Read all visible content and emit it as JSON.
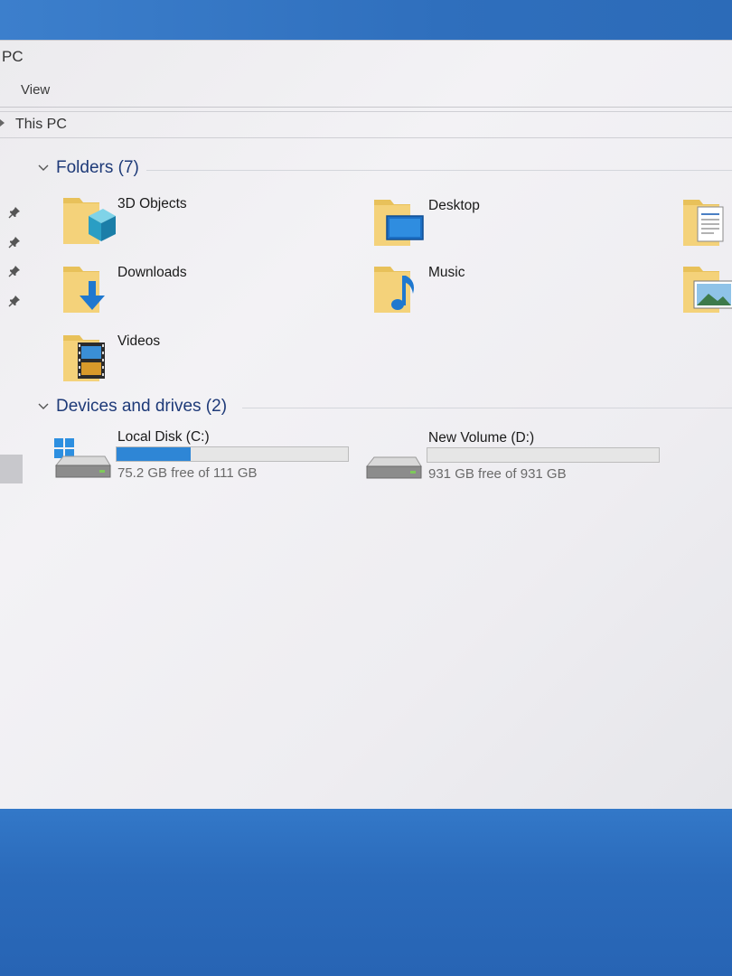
{
  "window": {
    "title": "PC"
  },
  "ribbon": {
    "tabs": [
      {
        "label": "View"
      }
    ]
  },
  "address_bar": {
    "path": "This PC"
  },
  "nav_pane": {
    "pinned_icons": [
      "pin-icon",
      "pin-icon",
      "pin-icon",
      "pin-icon"
    ]
  },
  "folders": {
    "header": "Folders (7)",
    "items": [
      {
        "name": "3D Objects",
        "icon": "3d-objects-folder-icon"
      },
      {
        "name": "Desktop",
        "icon": "desktop-folder-icon"
      },
      {
        "name": "",
        "icon": "documents-folder-icon"
      },
      {
        "name": "Downloads",
        "icon": "downloads-folder-icon"
      },
      {
        "name": "Music",
        "icon": "music-folder-icon"
      },
      {
        "name": "",
        "icon": "pictures-folder-icon"
      },
      {
        "name": "Videos",
        "icon": "videos-folder-icon"
      }
    ]
  },
  "drives": {
    "header": "Devices and drives (2)",
    "items": [
      {
        "name": "Local Disk (C:)",
        "free_text": "75.2 GB free of 111 GB",
        "used_fraction": 0.32,
        "icon": "windows-drive-icon"
      },
      {
        "name": "New Volume (D:)",
        "free_text": "931 GB free of 931 GB",
        "used_fraction": 0.0,
        "icon": "drive-icon"
      }
    ]
  },
  "colors": {
    "accent": "#2e86d6",
    "group_header": "#1e3a78",
    "desktop": "#2f6fc0"
  }
}
